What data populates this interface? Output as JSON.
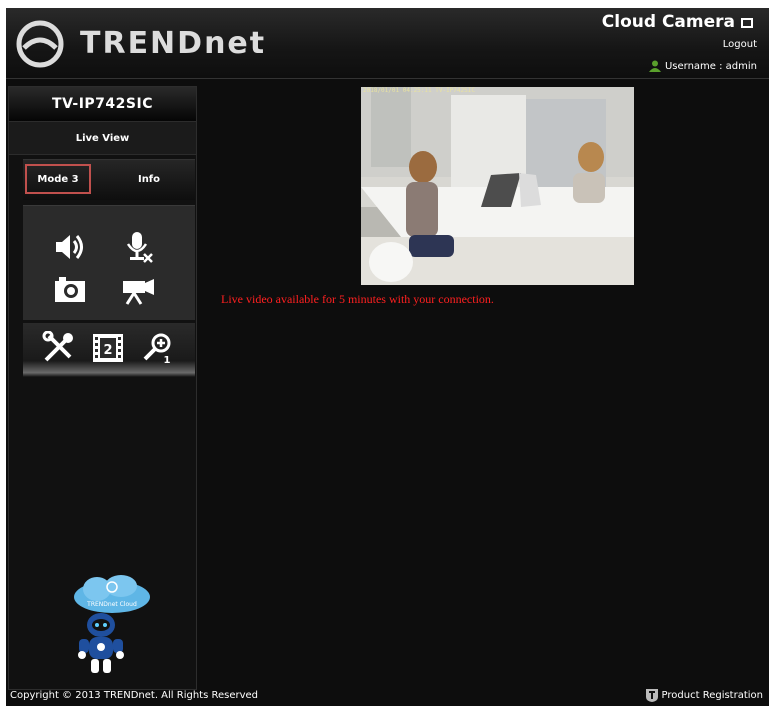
{
  "header": {
    "brand": "TRENDnet",
    "product_name": "Cloud Camera",
    "logout_label": "Logout",
    "user_label": "Username : admin"
  },
  "sidebar": {
    "model": "TV-IP742SIC",
    "section_title": "Live View",
    "tabs": [
      {
        "label": "Mode 3",
        "selected": true
      },
      {
        "label": "Info",
        "selected": false
      }
    ],
    "controls": [
      "speaker-icon",
      "mic-mute-icon",
      "snapshot-camera-icon",
      "video-record-icon"
    ],
    "tools": [
      "settings-tools-icon",
      "film-mode-2-icon",
      "zoom-1-icon"
    ],
    "mascot_text": "TRENDnet Cloud"
  },
  "video": {
    "osd_text": "2018/01/01 04:25:11 TV-IP742SIC"
  },
  "notice": "Live video available for 5 minutes with your connection.",
  "footer": {
    "copyright": "Copyright © 2013 TRENDnet. All Rights Reserved",
    "product_registration": "Product Registration"
  },
  "colors": {
    "background": "#0d0d0d",
    "notice": "#ff2020",
    "selected_tab_border": "#c0504d",
    "user_icon": "#5aa02c"
  }
}
